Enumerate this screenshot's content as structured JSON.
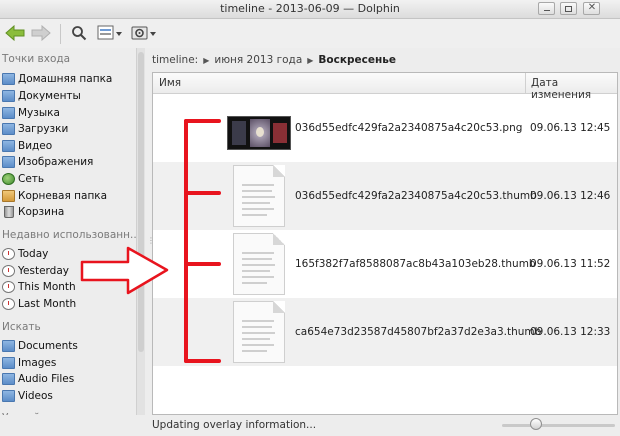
{
  "window": {
    "title": "timeline - 2013-06-09 — Dolphin"
  },
  "toolbar": {
    "back_icon": "back-arrow-icon",
    "forward_icon": "forward-arrow-icon",
    "search_icon": "search-icon",
    "view_mode_icon": "view-mode-icon",
    "settings_icon": "gear-icon"
  },
  "sidebar": {
    "sections": [
      {
        "title": "Точки входа",
        "items": [
          {
            "label": "Домашняя папка",
            "icon": "folder-icon"
          },
          {
            "label": "Документы",
            "icon": "folder-icon"
          },
          {
            "label": "Музыка",
            "icon": "folder-icon"
          },
          {
            "label": "Загрузки",
            "icon": "folder-icon"
          },
          {
            "label": "Видео",
            "icon": "folder-icon"
          },
          {
            "label": "Изображения",
            "icon": "folder-icon"
          },
          {
            "label": "Сеть",
            "icon": "network-icon"
          },
          {
            "label": "Корневая папка",
            "icon": "folder-icon"
          },
          {
            "label": "Корзина",
            "icon": "trash-icon"
          }
        ]
      },
      {
        "title": "Недавно использованн...",
        "items": [
          {
            "label": "Today",
            "icon": "clock-icon"
          },
          {
            "label": "Yesterday",
            "icon": "clock-icon"
          },
          {
            "label": "This Month",
            "icon": "clock-icon"
          },
          {
            "label": "Last Month",
            "icon": "clock-icon"
          }
        ]
      },
      {
        "title": "Искать",
        "items": [
          {
            "label": "Documents",
            "icon": "folder-icon"
          },
          {
            "label": "Images",
            "icon": "folder-icon"
          },
          {
            "label": "Audio Files",
            "icon": "folder-icon"
          },
          {
            "label": "Videos",
            "icon": "folder-icon"
          }
        ]
      },
      {
        "title": "Устройства",
        "items": []
      }
    ]
  },
  "breadcrumb": {
    "parts": [
      "timeline:",
      "июня 2013 года",
      "Воскресенье"
    ]
  },
  "view": {
    "columns": {
      "name": "Имя",
      "date": "Дата изменения"
    },
    "files": [
      {
        "name": "036d55edfc429fa2a2340875a4c20c53.png",
        "date": "09.06.13 12:45",
        "kind": "image"
      },
      {
        "name": "036d55edfc429fa2a2340875a4c20c53.thumb",
        "date": "09.06.13 12:46",
        "kind": "document"
      },
      {
        "name": "165f382f7af8588087ac8b43a103eb28.thumb",
        "date": "09.06.13 11:52",
        "kind": "document"
      },
      {
        "name": "ca654e73d23587d45807bf2a37d2e3a3.thumb",
        "date": "09.06.13 12:33",
        "kind": "document"
      }
    ]
  },
  "status": {
    "text": "Updating overlay information...",
    "zoom_level": 0.3
  },
  "colors": {
    "annotation": "#e8141e",
    "folder": "#6f9bd4"
  }
}
